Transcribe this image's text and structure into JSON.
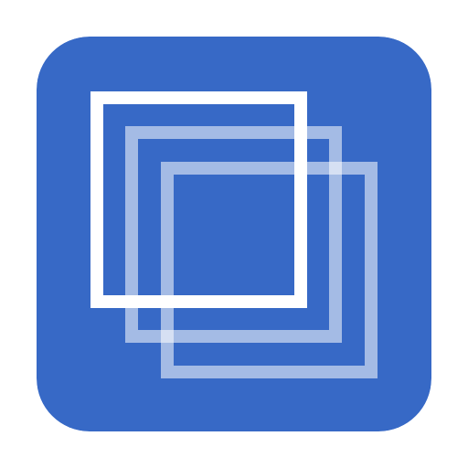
{
  "icon": {
    "name": "stacked-squares-icon",
    "background_color": "#3769C6",
    "front_square_color": "#FFFFFF",
    "back_square_color": "#FFFFFF",
    "front_square_opacity": 1.0,
    "back_square_opacity": 0.55
  }
}
